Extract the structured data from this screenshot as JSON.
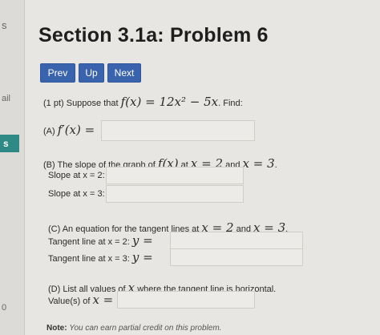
{
  "left_strip": {
    "texts": [
      "s",
      "ail",
      "s",
      "0"
    ]
  },
  "header": {
    "title": "Section 3.1a: Problem 6"
  },
  "nav": {
    "prev": "Prev",
    "up": "Up",
    "next": "Next"
  },
  "problem": {
    "intro_prefix": "(1 pt) Suppose that",
    "function_expr": "f(x) = 12x² − 5x",
    "intro_suffix": ". Find:",
    "part_a_label": "(A)",
    "part_a_expr": "f′(x) =",
    "part_b_prefix": "(B) The slope of the graph of",
    "part_b_fx": "f(x)",
    "part_b_at": "at",
    "part_b_x2": "x = 2",
    "part_b_and": "and",
    "part_b_x3": "x = 3",
    "part_b_period": ".",
    "slope_x2_label": "Slope at x = 2:",
    "slope_x3_label": "Slope at x = 3:",
    "part_c_prefix": "(C) An equation for the tangent lines at",
    "part_c_x2": "x = 2",
    "part_c_and": "and",
    "part_c_x3": "x = 3",
    "part_c_period": ".",
    "tangent_x2_label": "Tangent line at x = 2:",
    "tangent_x2_y": "y =",
    "tangent_x3_label": "Tangent line at x = 3:",
    "tangent_x3_y": "y =",
    "part_d_prefix": "(D) List all values of",
    "part_d_x": "x",
    "part_d_suffix": "where the tangent line is horizontal.",
    "values_label": "Value(s) of",
    "values_x": "x =",
    "note_label": "Note:",
    "note_text": "You can earn partial credit on this problem."
  }
}
